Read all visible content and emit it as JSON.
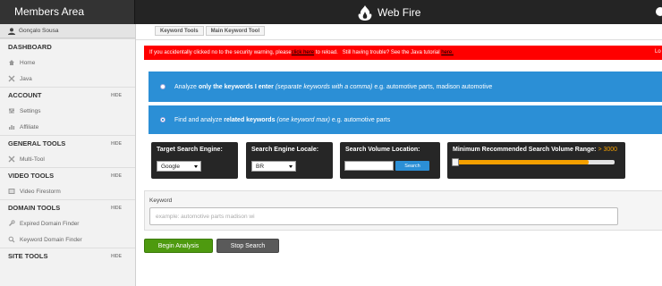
{
  "header": {
    "title": "Members Area",
    "logo_text": "Web Fire",
    "logo_icon": "flame-icon"
  },
  "sidebar": {
    "user_name": "Gonçalo Sousa",
    "sections": [
      {
        "title": "DASHBOARD",
        "hide_label": "",
        "items": [
          {
            "label": "Home",
            "icon": "home-icon"
          },
          {
            "label": "Java",
            "icon": "tools-icon"
          }
        ]
      },
      {
        "title": "ACCOUNT",
        "hide_label": "HIDE",
        "items": [
          {
            "label": "Settings",
            "icon": "sliders-icon"
          },
          {
            "label": "Affiliate",
            "icon": "chart-icon"
          }
        ]
      },
      {
        "title": "GENERAL TOOLS",
        "hide_label": "HIDE",
        "items": [
          {
            "label": "Multi-Tool",
            "icon": "tools-icon"
          }
        ]
      },
      {
        "title": "VIDEO TOOLS",
        "hide_label": "HIDE",
        "items": [
          {
            "label": "Video Firestorm",
            "icon": "film-icon"
          }
        ]
      },
      {
        "title": "DOMAIN TOOLS",
        "hide_label": "HIDE",
        "items": [
          {
            "label": "Expired Domain Finder",
            "icon": "wrench-icon"
          },
          {
            "label": "Keyword Domain Finder",
            "icon": "search-icon"
          }
        ]
      },
      {
        "title": "SITE TOOLS",
        "hide_label": "HIDE",
        "items": []
      }
    ]
  },
  "breadcrumbs": [
    "Keyword Tools",
    "Main Keyword Tool"
  ],
  "alert": {
    "text_before": "If you accidentally clicked no to the security warning, please ",
    "link1": "click here",
    "text_middle": " to reload.   Still having trouble? See the Java tutorial ",
    "link2": "here.",
    "tail": "Lo"
  },
  "options": {
    "opt1": {
      "pre": "Analyze ",
      "bold": "only the keywords I enter",
      "paren": " (separate keywords with a comma)",
      "post": " e.g. automotive parts, madison automotive"
    },
    "opt2": {
      "pre": "Find and analyze ",
      "bold": "related keywords",
      "paren": " (one keyword max)",
      "post": " e.g. automotive parts"
    }
  },
  "controls": {
    "engine_label": "Target Search Engine:",
    "engine_value": "Google",
    "locale_label": "Search Engine Locale:",
    "locale_value": "BR",
    "volume_location_label": "Search Volume Location:",
    "search_button": "Search",
    "min_volume_label": "Minimum Recommended Search Volume Range:",
    "min_volume_value": "> 3000",
    "slider_fill_fraction": 0.84
  },
  "keyword": {
    "label": "Keyword",
    "placeholder": "example: automotive parts madison wi"
  },
  "buttons": {
    "begin": "Begin Analysis",
    "stop": "Stop Search"
  },
  "colors": {
    "alert_red": "#ff0000",
    "option_blue": "#2b8fd6",
    "accent_orange": "#f5a000",
    "begin_green": "#4e9a0f"
  }
}
